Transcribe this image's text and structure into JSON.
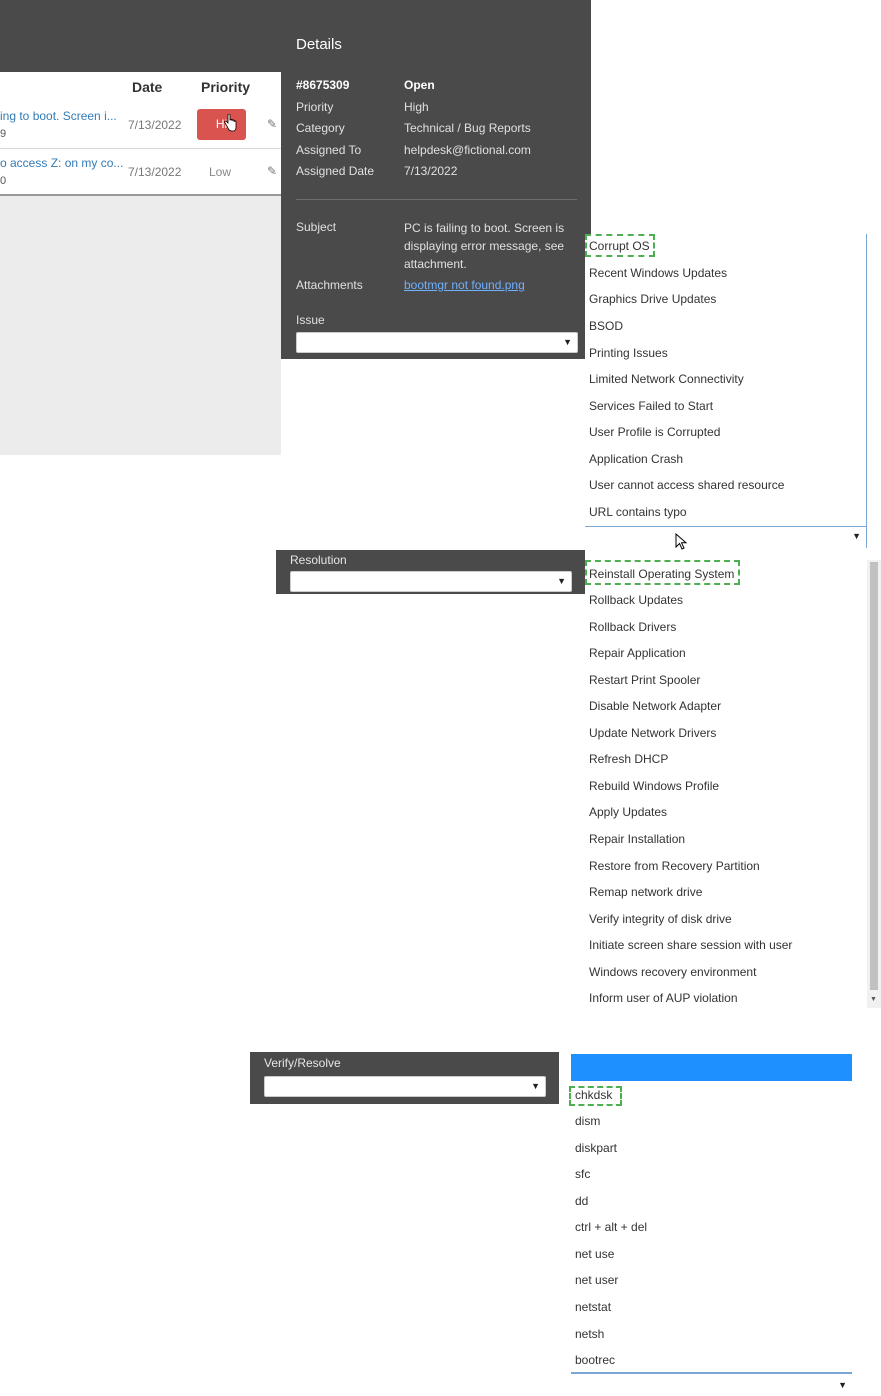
{
  "grid": {
    "headers": {
      "date": "Date",
      "priority": "Priority"
    },
    "rows": [
      {
        "subject": "ing to boot. Screen i...",
        "sub": "9",
        "date": "7/13/2022",
        "priority": "Hi"
      },
      {
        "subject": "o access Z: on my co...",
        "sub": "0",
        "date": "7/13/2022",
        "priority": "Low"
      }
    ]
  },
  "details": {
    "title": "Details",
    "ticket_id": "#8675309",
    "status": "Open",
    "fields": [
      {
        "label": "Priority",
        "value": "High"
      },
      {
        "label": "Category",
        "value": "Technical / Bug Reports"
      },
      {
        "label": "Assigned To",
        "value": "helpdesk@fictional.com"
      },
      {
        "label": "Assigned Date",
        "value": "7/13/2022"
      }
    ],
    "subject_label": "Subject",
    "subject_value": "PC is failing to boot. Screen is displaying error message, see attachment.",
    "attachments_label": "Attachments",
    "attachment_link": "bootmgr not found.png",
    "issue_label": "Issue"
  },
  "issue_options": [
    "Corrupt OS",
    "Recent Windows Updates",
    "Graphics Drive Updates",
    "BSOD",
    "Printing Issues",
    "Limited Network Connectivity",
    "Services Failed to Start",
    "User Profile is Corrupted",
    "Application Crash",
    "User cannot access shared resource",
    "URL contains typo"
  ],
  "resolution": {
    "label": "Resolution",
    "options": [
      "Reinstall Operating System",
      "Rollback Updates",
      "Rollback Drivers",
      "Repair Application",
      "Restart Print Spooler",
      "Disable Network Adapter",
      "Update Network Drivers",
      "Refresh DHCP",
      "Rebuild Windows Profile",
      "Apply Updates",
      "Repair Installation",
      "Restore from Recovery Partition",
      "Remap network drive",
      "Verify integrity of disk drive",
      "Initiate screen share session with user",
      "Windows recovery environment",
      "Inform user of AUP violation"
    ]
  },
  "verify": {
    "label": "Verify/Resolve",
    "options": [
      "chkdsk",
      "dism",
      "diskpart",
      "sfc",
      "dd",
      "ctrl + alt + del",
      "net use",
      "net user",
      "netstat",
      "netsh",
      "bootrec"
    ]
  },
  "colors": {
    "panel_bg": "#4a4a4a",
    "high_badge": "#d9534f",
    "highlight_border": "#4caf50",
    "selected_blue": "#1e90ff"
  }
}
